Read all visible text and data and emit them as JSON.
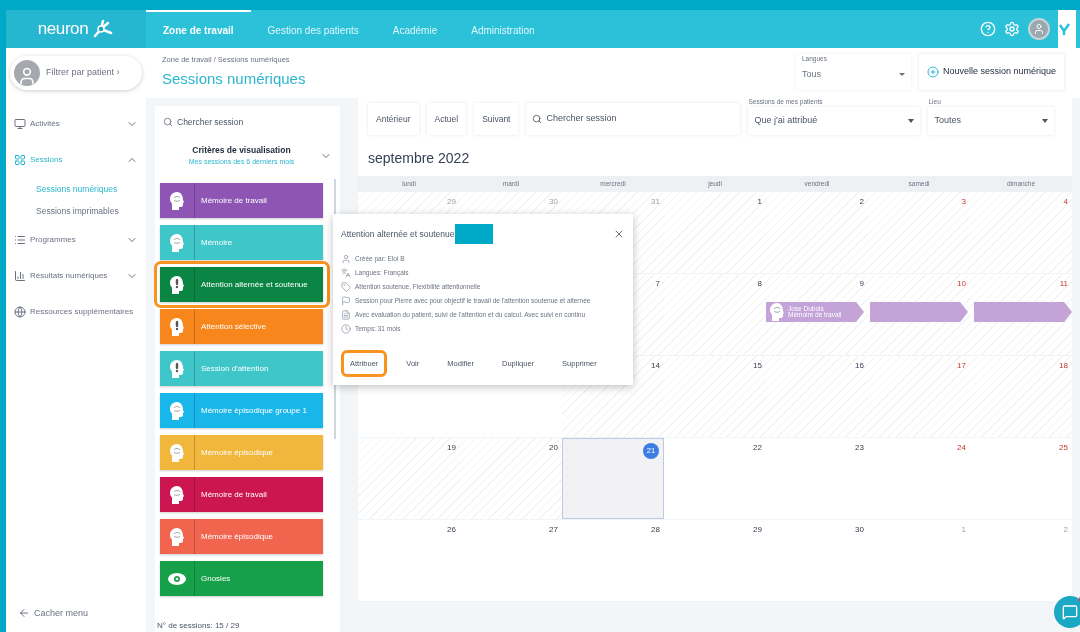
{
  "header": {
    "logo": "neuron",
    "tabs": [
      {
        "label": "Zone de travail",
        "selected": true
      },
      {
        "label": "Gestion des patients",
        "selected": false
      },
      {
        "label": "Académie",
        "selected": false
      },
      {
        "label": "Administration",
        "selected": false
      }
    ]
  },
  "sidebar": {
    "patient_filter": "Filtrer par patient ›",
    "items": [
      {
        "label": "Activités",
        "expanded": false,
        "selected": false
      },
      {
        "label": "Sessions",
        "expanded": true,
        "selected": true,
        "children": [
          {
            "label": "Sessions numériques",
            "selected": true
          },
          {
            "label": "Sessions imprimables",
            "selected": false
          }
        ]
      },
      {
        "label": "Programmes",
        "expanded": false,
        "selected": false
      },
      {
        "label": "Résultats numériques",
        "expanded": false,
        "selected": false
      },
      {
        "label": "Ressources supplémentaires"
      }
    ],
    "hide_menu": "Cacher menu"
  },
  "page": {
    "breadcrumb": "Zone de travail / Sessions numériques",
    "title": "Sessions numériques",
    "language": {
      "label": "Langues",
      "value": "Tous"
    },
    "new_session": "Nouvelle session numérique"
  },
  "session_list": {
    "search_placeholder": "Chercher session",
    "criteria_title": "Critères de visualisation",
    "criteria_subtitle": "Mes sessions des 6 derniers mois",
    "sessions": [
      {
        "name": "Mémoire de travail",
        "kind": "memory",
        "color": "#8e55b5",
        "highlighted": false
      },
      {
        "name": "Mémoire",
        "kind": "memory",
        "color": "#3ec6c9",
        "highlighted": false
      },
      {
        "name": "Attention alternée et soutenue",
        "kind": "attention",
        "color": "#0b8543",
        "highlighted": true
      },
      {
        "name": "Attention sélective",
        "kind": "attention",
        "color": "#f7861c",
        "highlighted": false
      },
      {
        "name": "Session d'attention",
        "kind": "attention",
        "color": "#3ec6c9",
        "highlighted": false
      },
      {
        "name": "Mémoire épisodique groupe 1",
        "kind": "memory",
        "color": "#19b6ea",
        "highlighted": false
      },
      {
        "name": "Mémoire épisodique",
        "kind": "memory",
        "color": "#f1b73c",
        "highlighted": false
      },
      {
        "name": "Mémoire de travail",
        "kind": "memory",
        "color": "#cc1651",
        "highlighted": false
      },
      {
        "name": "Mémoire épisodique",
        "kind": "memory",
        "color": "#f1644e",
        "highlighted": false
      },
      {
        "name": "Gnosies",
        "kind": "gnosis",
        "color": "#16a04a",
        "highlighted": false
      }
    ],
    "count": "N° de sessions: 15 / 29"
  },
  "calendar": {
    "nav": [
      "Antérieur",
      "Actuel",
      "Suivant"
    ],
    "search_placeholder": "Chercher session",
    "patients_filter": {
      "label": "Sessions de mes patients",
      "value": "Que j'ai attribué"
    },
    "type_filter": {
      "label": "Lieu",
      "value": "Toutes"
    },
    "month": "septembre 2022",
    "weekdays": [
      "lundi",
      "mardi",
      "mercredi",
      "jeudi",
      "vendredi",
      "samedi",
      "dimanche"
    ],
    "weeks": [
      {
        "days": [
          {
            "day": "29",
            "other_month": true,
            "past": true
          },
          {
            "day": "30",
            "other_month": true,
            "past": true
          },
          {
            "day": "31",
            "other_month": true,
            "past": true
          },
          {
            "day": "1",
            "past": true
          },
          {
            "day": "2",
            "past": true
          },
          {
            "day": "3",
            "past": true
          },
          {
            "day": "4",
            "past": true
          }
        ]
      },
      {
        "days": [
          {
            "day": "7",
            "past": true
          },
          {
            "day": "8",
            "past": true
          },
          {
            "day": "9",
            "past": true,
            "event": {
              "patient": "Jose Dubois",
              "session": "Mémoire de travail",
              "color": "#c3a3d8"
            }
          },
          {
            "day": "10",
            "past": true
          },
          {
            "day": "11",
            "past": true
          }
        ]
      },
      {
        "days": [
          {
            "day": "14",
            "past": true
          },
          {
            "day": "15",
            "past": true
          },
          {
            "day": "16",
            "past": true
          },
          {
            "day": "17",
            "past": true
          },
          {
            "day": "18",
            "past": true
          }
        ]
      },
      {
        "days": [
          {
            "day": "19",
            "past": true
          },
          {
            "day": "20",
            "past": true
          },
          {
            "day": "21",
            "today": true
          },
          {
            "day": "22"
          },
          {
            "day": "23"
          },
          {
            "day": "24"
          },
          {
            "day": "25"
          }
        ]
      },
      {
        "days": [
          {
            "day": "26"
          },
          {
            "day": "27"
          },
          {
            "day": "28"
          },
          {
            "day": "29"
          },
          {
            "day": "30"
          },
          {
            "day": "1",
            "other_month": true
          },
          {
            "day": "2",
            "other_month": true
          }
        ]
      }
    ]
  },
  "popup": {
    "title": "Attention alternée et soutenue",
    "details": [
      "Créée par: Eloi B",
      "Langues: Français",
      "Attention soutenue, Flexibilité attentionnelle",
      "Session pour Pierre avec pour objectif le travail de l'attention soutenue et alternée",
      "Avec évaluation du patient, suivi de l'attention et du calcul. Avec suivi en continu",
      "Temps: 31 mois"
    ],
    "actions": [
      {
        "label": "Attribuer",
        "highlighted": true
      },
      {
        "label": "Voir",
        "highlighted": false
      },
      {
        "label": "Modifier",
        "highlighted": false
      },
      {
        "label": "Dupliquer",
        "highlighted": false
      },
      {
        "label": "Supprimer",
        "highlighted": false
      }
    ]
  }
}
